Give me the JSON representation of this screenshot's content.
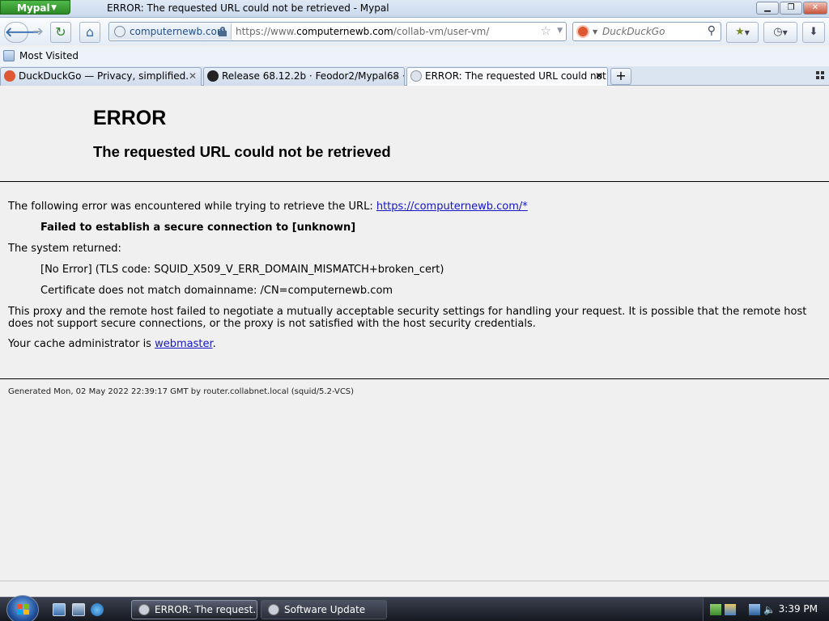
{
  "window": {
    "app_button": "Mypal",
    "title": "ERROR: The requested URL could not be retrieved - Mypal"
  },
  "navbar": {
    "site_identity": "computernewb.com",
    "url_prefix": "https://www.",
    "url_domain": "computernewb.com",
    "url_path": "/collab-vm/user-vm/",
    "search_placeholder": "DuckDuckGo"
  },
  "bookmarks": {
    "items": [
      {
        "label": "Most Visited"
      }
    ]
  },
  "tabs": [
    {
      "label": "DuckDuckGo — Privacy, simplified.",
      "icon": "duckduckgo-icon",
      "active": false
    },
    {
      "label": "Release 68.12.2b · Feodor2/Mypal68 · ...",
      "icon": "github-icon",
      "active": false
    },
    {
      "label": "ERROR: The requested URL could not ...",
      "icon": "globe-icon",
      "active": true
    }
  ],
  "page": {
    "heading": "ERROR",
    "subheading": "The requested URL could not be retrieved",
    "intro_text": "The following error was encountered while trying to retrieve the URL: ",
    "intro_link": "https://computernewb.com/*",
    "error_bold": "Failed to establish a secure connection to [unknown]",
    "system_returned": "The system returned:",
    "tls_code": "[No Error] (TLS code: SQUID_X509_V_ERR_DOMAIN_MISMATCH+broken_cert)",
    "cert_mismatch": "Certificate does not match domainname: /CN=computernewb.com",
    "explanation": "This proxy and the remote host failed to negotiate a mutually acceptable security settings for handling your request. It is possible that the remote host does not support secure connections, or the proxy is not satisfied with the host security credentials.",
    "admin_text": "Your cache administrator is ",
    "admin_link": "webmaster",
    "admin_suffix": ".",
    "footer": "Generated Mon, 02 May 2022 22:39:17 GMT by router.collabnet.local (squid/5.2-VCS)"
  },
  "taskbar": {
    "tasks": [
      {
        "label": "ERROR: The request...",
        "active": true
      },
      {
        "label": "Software Update",
        "active": false
      }
    ],
    "clock": "3:39 PM"
  },
  "colors": {
    "link": "#1515c8",
    "start_orb": "#1f4f9a",
    "app_button": "#2c8a26"
  }
}
